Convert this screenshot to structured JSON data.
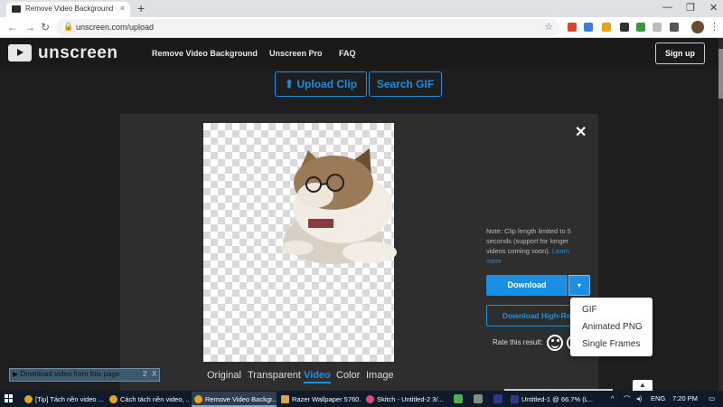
{
  "browser": {
    "tab_title": "Remove Video Background – Unscreen",
    "tab_close": "×",
    "new_tab": "+",
    "url": "unscreen.com/upload",
    "window_controls": [
      "—",
      "❐",
      "✕"
    ]
  },
  "header": {
    "logo": "unscreen",
    "nav": [
      "Remove Video Background",
      "Unscreen Pro",
      "FAQ"
    ],
    "signup": "Sign up"
  },
  "upload": {
    "upload_clip": "Upload Clip",
    "search_gif": "Search GIF"
  },
  "result": {
    "close": "✕",
    "note": "Note: Clip length limited to 5 seconds (support for longer videos coming soon).",
    "learn_more": "Learn more",
    "download": "Download",
    "download_hr": "Download High-Resolution",
    "rate_label": "Rate this result:",
    "tabs": [
      "Original",
      "Transparent",
      "Video",
      "Color",
      "Image"
    ],
    "active_tab": "Video"
  },
  "dropdown": {
    "items": [
      "GIF",
      "Animated PNG",
      "Single Frames"
    ]
  },
  "download_widget": {
    "label": "Download video from this page",
    "btn_count": "2",
    "btn_close": "X"
  },
  "taskbar": {
    "items": [
      "[Tip] Tách nền video ...",
      "Cách tách nền video, ...",
      "Remove Video Backgr...",
      "Razer Wallpaper 5760...",
      "Skitch - Untitled-2 3/...",
      "Untitled-1 @ 66.7% (L..."
    ],
    "language": "ENG",
    "time": "7:20 PM"
  },
  "colors": {
    "accent": "#1a8fe3",
    "page_bg": "#1e1e1e",
    "panel_bg": "#2e2e2e"
  }
}
